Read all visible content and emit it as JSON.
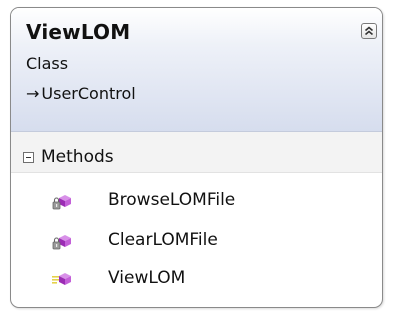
{
  "class_shape": {
    "name": "ViewLOM",
    "stereotype": "Class",
    "inheritance_arrow": "→",
    "base_class": "UserControl"
  },
  "section": {
    "label": "Methods",
    "toggle_symbol": "−"
  },
  "methods": [
    {
      "label": "BrowseLOMFile",
      "icon": "private-method-icon"
    },
    {
      "label": "ClearLOMFile",
      "icon": "private-method-icon"
    },
    {
      "label": "ViewLOM",
      "icon": "public-method-icon"
    }
  ]
}
